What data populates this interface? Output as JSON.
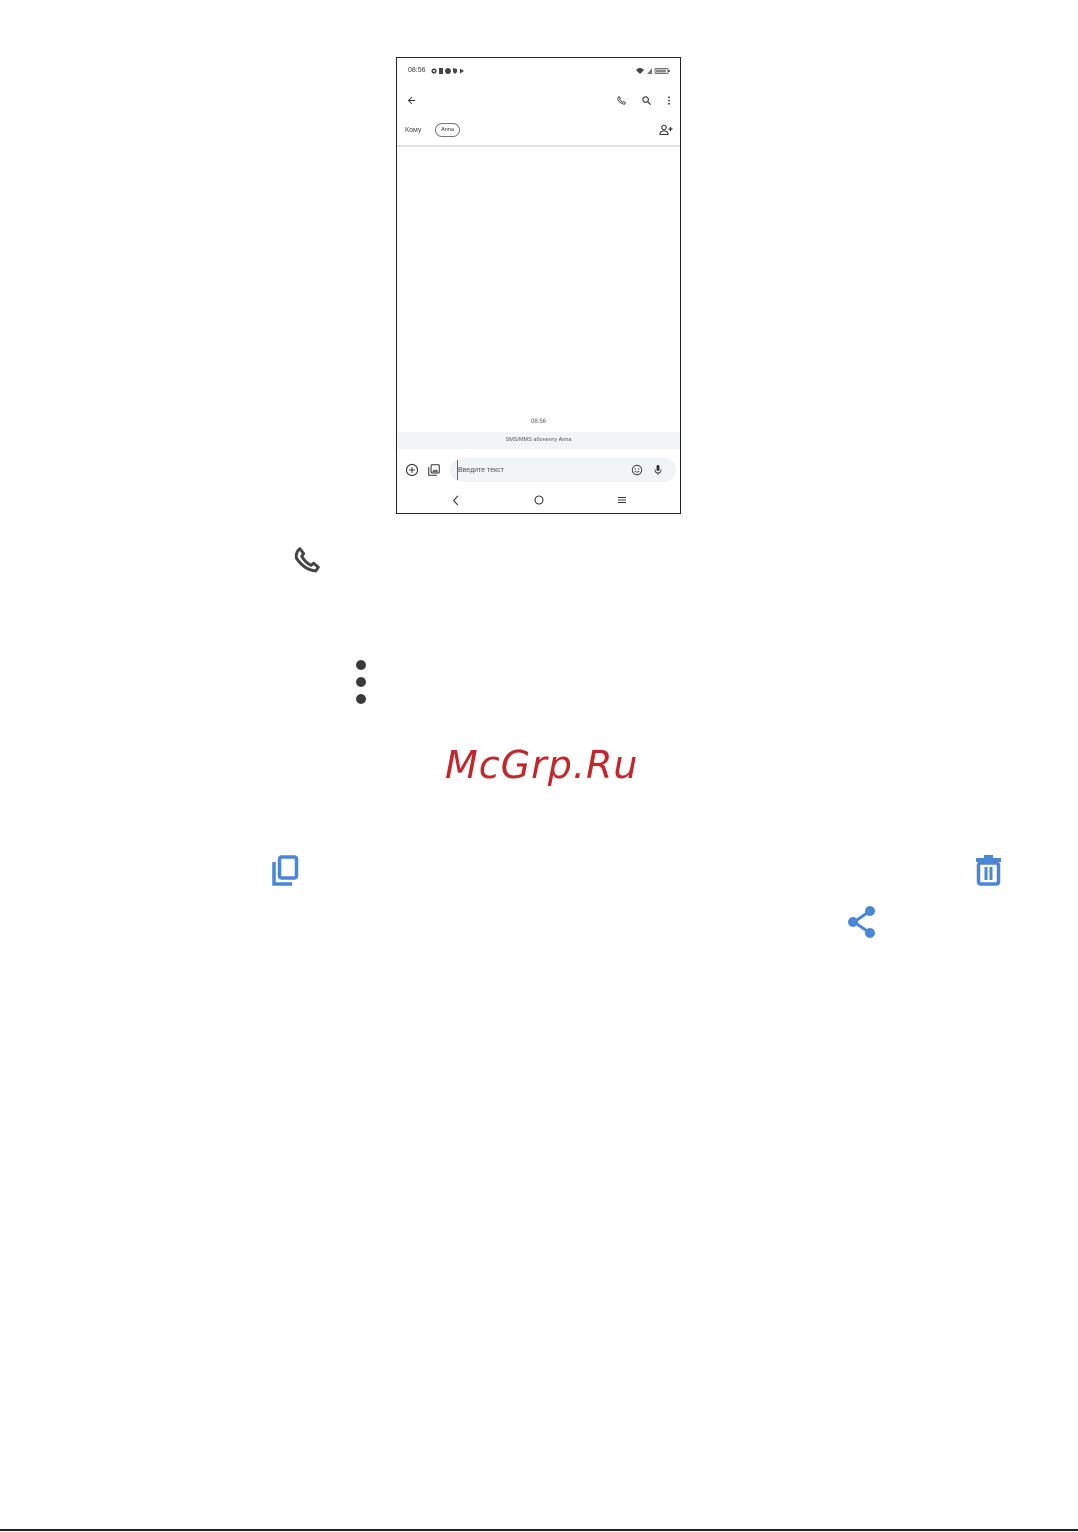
{
  "status_bar": {
    "time": "08:56",
    "left_icons": [
      "gear-icon",
      "sd-card-icon",
      "account-circle-icon",
      "shield-icon",
      "play-icon"
    ],
    "right_icons": [
      "wifi-icon",
      "signal-icon",
      "battery-icon"
    ]
  },
  "toolbar": {
    "icons": [
      "back-arrow-icon",
      "phone-icon",
      "search-icon",
      "more-vert-icon"
    ]
  },
  "recipients": {
    "label": "Кому",
    "chip": "Anna",
    "add_icon": "add-person-icon"
  },
  "conversation": {
    "timestamp": "08:56",
    "banner": "SMS/MMS абоненту Anna"
  },
  "composer": {
    "placeholder": "Введите текст",
    "value": "",
    "icons": [
      "add-circle-icon",
      "gallery-icon",
      "emoji-icon",
      "mic-icon"
    ]
  },
  "nav_bar": {
    "icons": [
      "back-chevron-icon",
      "home-circle-icon",
      "menu-icon"
    ]
  },
  "legend_icons": {
    "call": "phone-icon",
    "more": "more-vert-icon",
    "copy": "copy-icon",
    "delete": "delete-icon",
    "share": "share-icon"
  },
  "watermark": "McGrp.Ru",
  "colors": {
    "accent_blue": "#4a86d6",
    "watermark_red": "#c1272d",
    "icon_gray": "#444444"
  }
}
